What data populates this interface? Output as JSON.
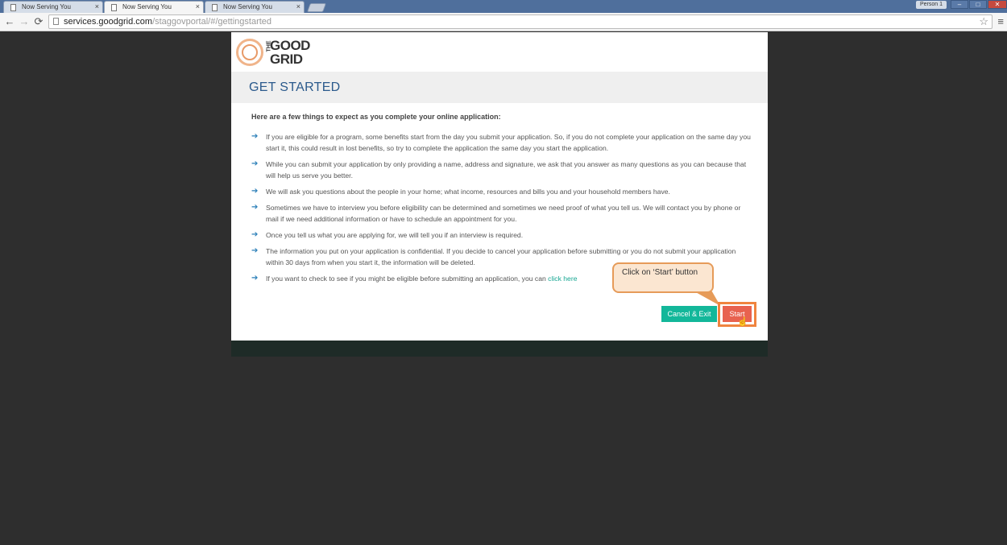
{
  "browser": {
    "tabs": [
      {
        "label": "Now Serving You",
        "active": false
      },
      {
        "label": "Now Serving You",
        "active": true
      },
      {
        "label": "Now Serving You",
        "active": false
      }
    ],
    "tab_close": "×",
    "profile_label": "Person 1",
    "window_buttons": {
      "minimize": "–",
      "maximize": "□",
      "close": "✕"
    },
    "url_host": "services.goodgrid.com",
    "url_path": "/staggovportal/#/gettingstarted",
    "nav": {
      "back": "←",
      "forward": "→",
      "reload": "⟳"
    },
    "star": "☆",
    "menu": "≡"
  },
  "logo": {
    "the": "THE",
    "line1": "GOOD",
    "line2": "GRID"
  },
  "page": {
    "title": "GET STARTED",
    "intro": "Here are a few things to expect as you complete your online application:",
    "bullet_icon": "arrow-right-icon",
    "bullets": [
      "If you are eligible for a program, some benefits start from the day you submit your application. So, if you do not complete your application on the same day you start it, this could result in lost benefits, so try to complete the application the same day you start the application.",
      "While you can submit your application by only providing a name, address and signature, we ask that you answer as many questions as you can because that will help us serve you better.",
      "We will ask you questions about the people in your home; what income, resources and bills you and your household members have.",
      "Sometimes we have to interview you before eligibility can be determined and sometimes we need proof of what you tell us. We will contact you by phone or mail if we need additional information or have to schedule an appointment for you.",
      "Once you tell us what you are applying for, we will tell you if an interview is required.",
      "The information you put on your application is confidential. If you decide to cancel your application before submitting or you do not submit your application within 30 days from when you start it, the information will be deleted."
    ],
    "last_bullet_text": "If you want to check to see if you might be eligible before submitting an application, you can",
    "last_bullet_link": "click here",
    "cancel_label": "Cancel & Exit",
    "start_label": "Start"
  },
  "callout": {
    "text": "Click on ‘Start’ button"
  },
  "colors": {
    "title": "#2b5a8c",
    "cancel_button": "#13b79a",
    "start_button": "#e8624f",
    "link": "#16a692",
    "highlight_outline": "#f0843f"
  }
}
